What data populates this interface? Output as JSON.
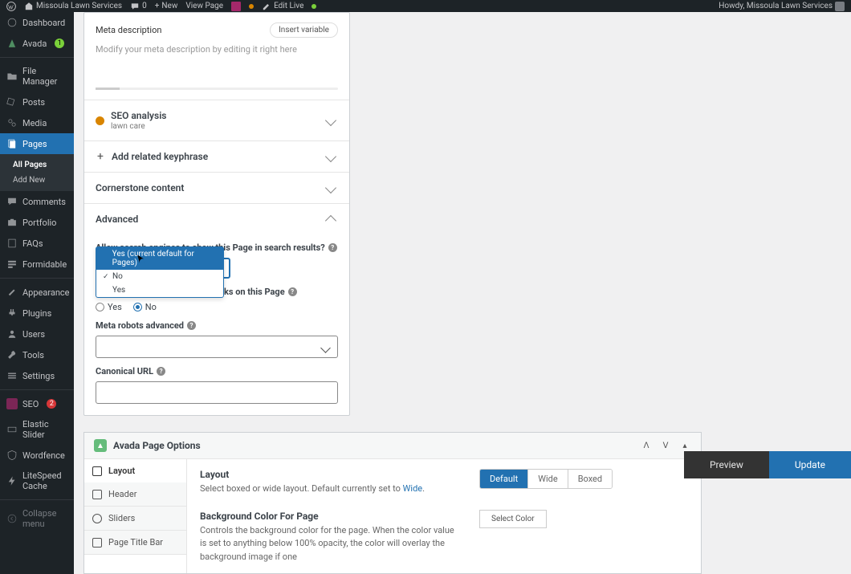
{
  "adminBar": {
    "siteName": "Missoula Lawn Services",
    "comments": "0",
    "new": "New",
    "viewPage": "View Page",
    "editLive": "Edit Live",
    "howdy": "Howdy, Missoula Lawn Services"
  },
  "sidebar": {
    "dashboard": "Dashboard",
    "avada": "Avada",
    "avadaBadge": "1",
    "fileManager": "File Manager",
    "posts": "Posts",
    "media": "Media",
    "pages": "Pages",
    "allPages": "All Pages",
    "addNew": "Add New",
    "comments": "Comments",
    "portfolio": "Portfolio",
    "faqs": "FAQs",
    "formidable": "Formidable",
    "appearance": "Appearance",
    "plugins": "Plugins",
    "users": "Users",
    "tools": "Tools",
    "settings": "Settings",
    "seo": "SEO",
    "seoBadge": "2",
    "elasticSlider": "Elastic Slider",
    "wordfence": "Wordfence",
    "litespeed": "LiteSpeed Cache",
    "collapse": "Collapse menu"
  },
  "yoast": {
    "metaDescLabel": "Meta description",
    "insertVariable": "Insert variable",
    "metaDescPlaceholder": "Modify your meta description by editing it right here",
    "seoAnalysis": "SEO analysis",
    "seoKeyword": "lawn care",
    "addKeyphrase": "Add related keyphrase",
    "cornerstone": "Cornerstone content",
    "advanced": "Advanced",
    "allowSearch": "Allow search engines to show this Page in search results?",
    "dropdown": {
      "yesDefault": "Yes (current default for Pages)",
      "no": "No",
      "yes": "Yes"
    },
    "followLinks": "Should search engines follow links on this Page",
    "radioYes": "Yes",
    "radioNo": "No",
    "metaRobots": "Meta robots advanced",
    "canonical": "Canonical URL"
  },
  "avada": {
    "title": "Avada Page Options",
    "nav": {
      "layout": "Layout",
      "header": "Header",
      "sliders": "Sliders",
      "pageTitleBar": "Page Title Bar"
    },
    "layout": {
      "heading": "Layout",
      "desc1": "Select boxed or wide layout. Default currently set to ",
      "descLink": "Wide",
      "segDefault": "Default",
      "segWide": "Wide",
      "segBoxed": "Boxed"
    },
    "bgcolor": {
      "heading": "Background Color For Page",
      "desc": "Controls the background color for the page. When the color value is set to anything below 100% opacity, the color will overlay the background image if one",
      "selectColor": "Select Color"
    }
  },
  "bottomBar": {
    "preview": "Preview",
    "update": "Update"
  }
}
